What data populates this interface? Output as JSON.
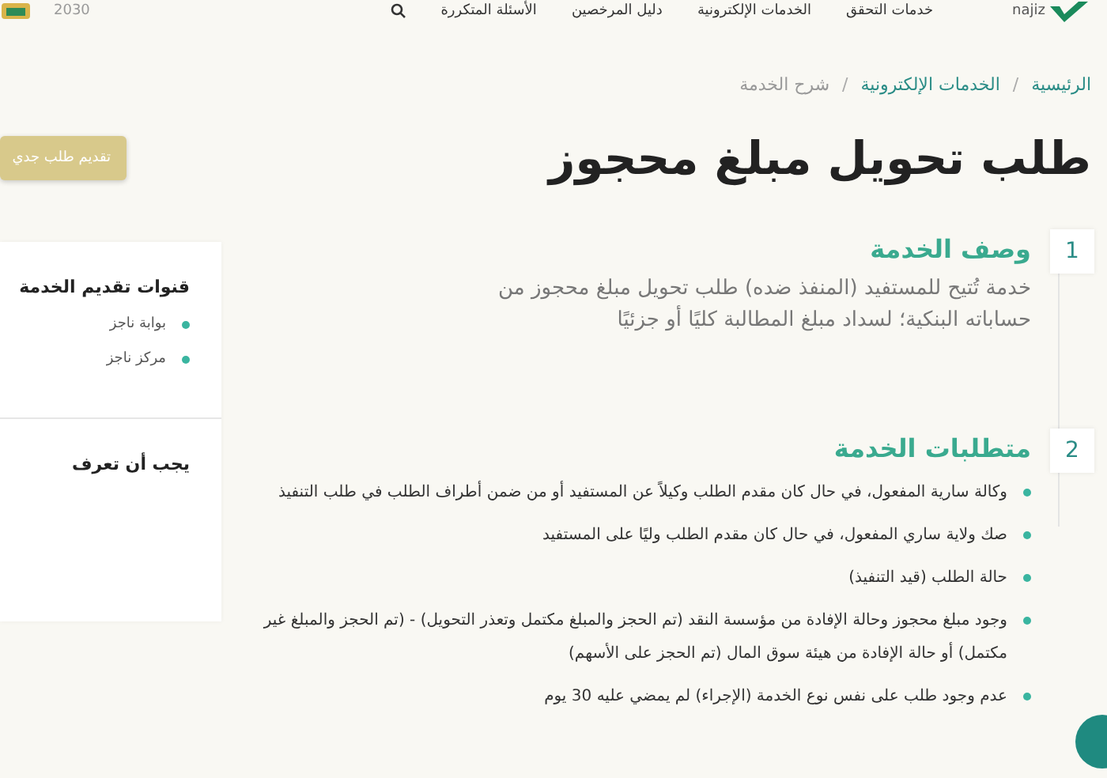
{
  "header": {
    "brand": "najiz",
    "nav": [
      "خدمات التحقق",
      "الخدمات الإلكترونية",
      "دليل المرخصين",
      "الأسئلة المتكررة"
    ],
    "vision": "2030"
  },
  "breadcrumb_separator": "/",
  "breadcrumb": [
    {
      "label": "الرئيسية",
      "link": true
    },
    {
      "label": "الخدمات الإلكترونية",
      "link": true
    },
    {
      "label": "شرح الخدمة",
      "link": false
    }
  ],
  "title": "طلب تحويل مبلغ محجوز",
  "new_request_button": "تقديم طلب جدي",
  "sections": [
    {
      "number": "1",
      "heading": "وصف الخدمة",
      "kind": "text",
      "text": "خدمة تُتيح للمستفيد (المنفذ ضده) طلب تحويل مبلغ محجوز من حساباته البنكية؛ لسداد مبلغ المطالبة كليًا أو جزئيًا"
    },
    {
      "number": "2",
      "heading": "متطلبات الخدمة",
      "kind": "list",
      "items": [
        "وكالة سارية المفعول، في حال كان مقدم الطلب وكيلاً عن المستفيد أو من ضمن أطراف الطلب في طلب التنفيذ",
        "صك ولاية ساري المفعول، في حال كان مقدم الطلب وليًا على المستفيد",
        "حالة الطلب (قيد التنفيذ)",
        "وجود مبلغ محجوز وحالة الإفادة من مؤسسة النقد (تم الحجز والمبلغ مكتمل وتعذر التحويل) - (تم الحجز والمبلغ غير مكتمل) أو حالة الإفادة من هيئة سوق المال (تم الحجز على الأسهم)",
        "عدم وجود طلب على نفس نوع الخدمة (الإجراء) لم يمضي عليه 30 يوم"
      ]
    }
  ],
  "sidebar": {
    "channels_title": "قنوات تقديم الخدمة",
    "channels": [
      "بوابة ناجز",
      "مركز ناجز"
    ],
    "know_title": "يجب أن تعرف"
  }
}
